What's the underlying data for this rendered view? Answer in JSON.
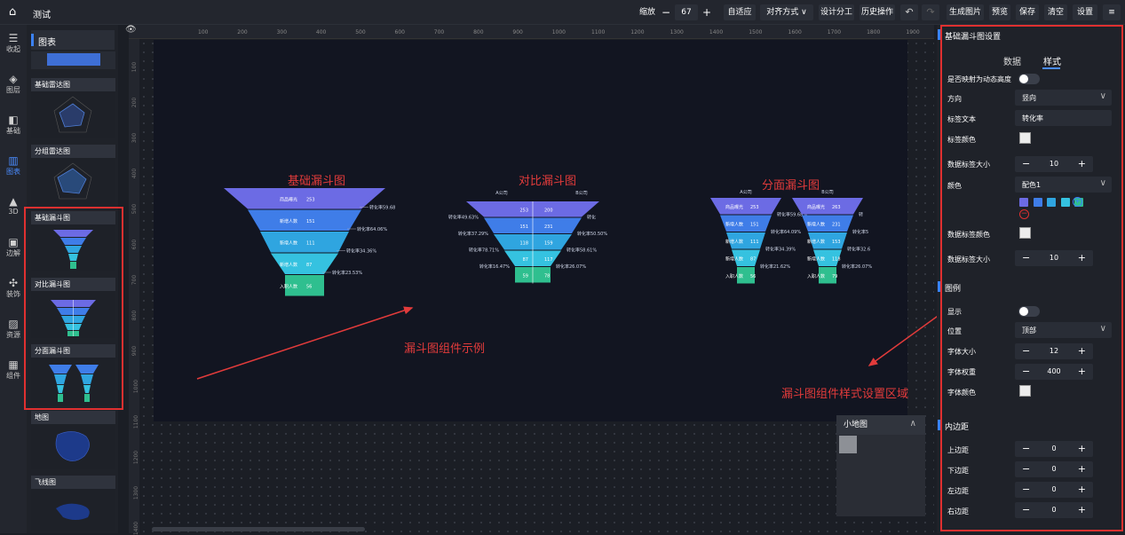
{
  "app": {
    "title": "测试"
  },
  "toolbar": {
    "zoom_label": "缩放",
    "zoom_minus": "−",
    "zoom_value": "67",
    "zoom_plus": "+",
    "fit": "自适应",
    "align": "对齐方式 ∨",
    "design": "设计分工",
    "history": "历史操作",
    "generate": "生成图片",
    "preview": "预览",
    "save": "保存",
    "clear": "清空",
    "settings": "设置",
    "menu": "≡"
  },
  "iconbar": {
    "items": [
      {
        "label": "收起",
        "icon": "collapse-icon"
      },
      {
        "label": "图层",
        "icon": "layers-icon"
      },
      {
        "label": "基础",
        "icon": "basic-icon"
      },
      {
        "label": "图表",
        "icon": "chart-icon"
      },
      {
        "label": "3D",
        "icon": "3d-icon"
      },
      {
        "label": "边解",
        "icon": "border-icon"
      },
      {
        "label": "装饰",
        "icon": "decor-icon"
      },
      {
        "label": "资源",
        "icon": "resource-icon"
      },
      {
        "label": "组件",
        "icon": "component-icon"
      }
    ]
  },
  "library": {
    "header": "图表",
    "cards": [
      "基础雷达图",
      "分组雷达图",
      "基础漏斗图",
      "对比漏斗图",
      "分面漏斗图",
      "地图",
      "飞线图"
    ]
  },
  "ruler": {
    "top": [
      "100",
      "200",
      "300",
      "400",
      "500",
      "600",
      "700",
      "800",
      "900",
      "1000",
      "1100",
      "1200",
      "1300",
      "1400",
      "1500",
      "1600",
      "1700",
      "1800",
      "1900"
    ],
    "left": [
      "100",
      "200",
      "300",
      "400",
      "500",
      "600",
      "700",
      "800",
      "900",
      "1000",
      "1100",
      "1200",
      "1300",
      "1400"
    ]
  },
  "canvas": {
    "annotations": {
      "basic_title": "基础漏斗图",
      "compare_title": "对比漏斗图",
      "facet_title": "分面漏斗图",
      "example": "漏斗图组件示例",
      "settings_area": "漏斗图组件样式设置区域"
    },
    "funnel_basic": {
      "stages": [
        {
          "name": "商品曝光",
          "value": "253"
        },
        {
          "name": "新增人数",
          "value": "151"
        },
        {
          "name": "新增人数",
          "value": "111"
        },
        {
          "name": "新增人数",
          "value": "87"
        },
        {
          "name": "入职人数",
          "value": "56"
        }
      ],
      "rates": [
        "转化率59.68",
        "转化率64.06%",
        "转化率34.36%",
        "转化率23.53%"
      ]
    },
    "funnel_compare": {
      "left_label": "A公司",
      "right_label": "B公司",
      "left_values": [
        "253",
        "151",
        "118",
        "87",
        "59"
      ],
      "right_values": [
        "200",
        "231",
        "159",
        "117",
        "78"
      ],
      "left_rates": [
        "转化率49.63%",
        "转化率37.29%",
        "转化率78.71%",
        "转化率16.47%"
      ],
      "right_rates": [
        "转化",
        "转化率50.50%",
        "转化率58.61%",
        "转化率26.07%"
      ]
    },
    "funnel_facet": {
      "left_label": "A公司",
      "right_label": "B公司",
      "stages": [
        "商品曝光",
        "新增人数",
        "新增人数",
        "新增人数",
        "入职人数"
      ],
      "left_values": [
        "253",
        "151",
        "111",
        "87",
        "56"
      ],
      "right_values": [
        "263",
        "231",
        "153",
        "118",
        "79"
      ],
      "left_rates": [
        "转化率59.68%",
        "转化率64.09%",
        "转化率34.39%",
        "转化率21.62%"
      ],
      "right_rates": [
        "转",
        "转化率5",
        "转化率32.6",
        "转化率26.07%"
      ]
    }
  },
  "minimap": {
    "title": "小地图",
    "collapse": "∧"
  },
  "props": {
    "header": "基础漏斗图设置",
    "tabs": [
      "数据",
      "样式"
    ],
    "dynamic_height": "是否映射为动态高度",
    "direction_label": "方向",
    "direction_value": "竖向",
    "label_text_label": "标签文本",
    "label_text_value": "转化率",
    "label_color_label": "标签颜色",
    "data_label_size_label": "数据标签大小",
    "data_label_size_value": "10",
    "color_label": "颜色",
    "color_value": "配色1",
    "palette": [
      "#6c6be4",
      "#3f7de8",
      "#2fa5e0",
      "#35c2e0",
      "#2fbf8f"
    ],
    "data_label_color_label": "数据标签颜色",
    "data_label_size2_label": "数据标签大小",
    "data_label_size2_value": "10",
    "legend_section": "图例",
    "show_label": "显示",
    "position_label": "位置",
    "position_value": "顶部",
    "font_size_label": "字体大小",
    "font_size_value": "12",
    "font_weight_label": "字体权重",
    "font_weight_value": "400",
    "font_color_label": "字体颜色",
    "padding_section": "内边距",
    "padding_top_label": "上边距",
    "padding_top_value": "0",
    "padding_bottom_label": "下边距",
    "padding_bottom_value": "0",
    "padding_left_label": "左边距",
    "padding_left_value": "0",
    "padding_right_label": "右边距",
    "padding_right_value": "0",
    "minus": "−",
    "plus": "+",
    "chevron": "∨"
  }
}
